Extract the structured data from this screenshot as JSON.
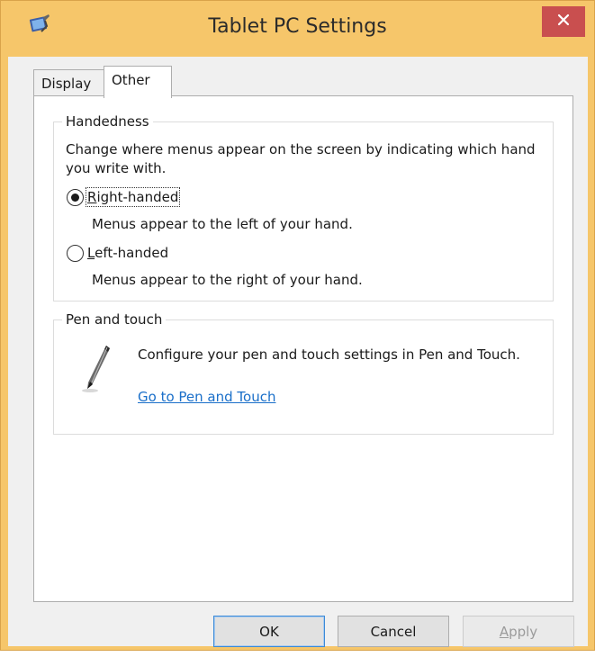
{
  "window": {
    "title": "Tablet PC Settings",
    "close_glyph": "✕",
    "accent_color": "#f6c66a",
    "close_color": "#c94f4f"
  },
  "tabs": [
    {
      "label": "Display",
      "selected": false
    },
    {
      "label": "Other",
      "selected": true
    }
  ],
  "handedness": {
    "legend": "Handedness",
    "description": "Change where menus appear on the screen by indicating which hand you write with.",
    "options": [
      {
        "label": "Right-handed",
        "mnemonic": "R",
        "sub": "Menus appear to the left of your hand.",
        "selected": true
      },
      {
        "label": "Left-handed",
        "mnemonic": "L",
        "sub": "Menus appear to the right of your hand.",
        "selected": false
      }
    ]
  },
  "pen_touch": {
    "legend": "Pen and touch",
    "icon": "pen-icon",
    "description": "Configure your pen and touch settings in Pen and Touch.",
    "link": "Go to Pen and Touch"
  },
  "buttons": {
    "ok": "OK",
    "cancel": "Cancel",
    "apply": "Apply",
    "apply_enabled": false
  }
}
